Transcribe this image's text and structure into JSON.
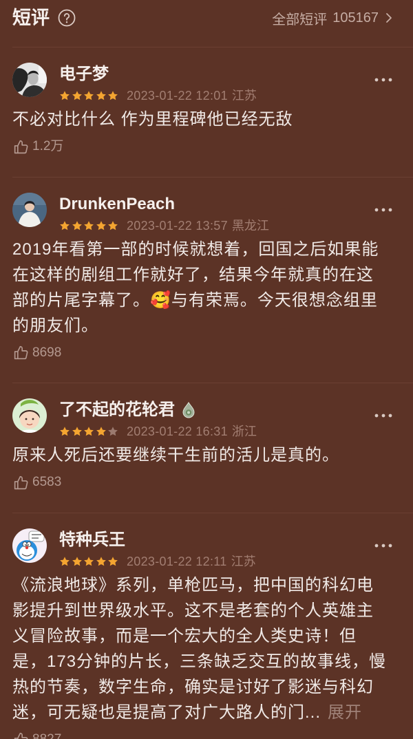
{
  "theme": {
    "background": "#5c3326",
    "text_primary": "#f2ebe8",
    "text_muted": "#a27e72",
    "star_filled": "#f4a531",
    "star_empty": "#9b7a6f",
    "divider": "#6b3f32"
  },
  "header": {
    "title": "短评",
    "help_icon": "question-circle-icon",
    "all_reviews_label": "全部短评",
    "all_reviews_count": "105167",
    "chevron_icon": "chevron-right-icon"
  },
  "reviews": [
    {
      "author": "电子梦",
      "rating": 5,
      "rating_max": 5,
      "date": "2023-01-22 12:01",
      "location": "江苏",
      "text": "不必对比什么 作为里程碑他已经无敌",
      "likes": "1.2万",
      "like_icon": "thumbs-up-icon",
      "more_icon": "more-dots-icon"
    },
    {
      "author": "DrunkenPeach",
      "rating": 5,
      "rating_max": 5,
      "date": "2023-01-22 13:57",
      "location": "黑龙江",
      "text": "2019年看第一部的时候就想着，回国之后如果能在这样的剧组工作就好了，结果今年就真的在这部的片尾字幕了。🥰与有荣焉。今天很想念组里的朋友们。",
      "likes": "8698",
      "like_icon": "thumbs-up-icon",
      "more_icon": "more-dots-icon"
    },
    {
      "author": "了不起的花轮君",
      "badge_icon": "medal-badge-icon",
      "rating": 4,
      "rating_max": 5,
      "date": "2023-01-22 16:31",
      "location": "浙江",
      "text": "原来人死后还要继续干生前的活儿是真的。",
      "likes": "6583",
      "like_icon": "thumbs-up-icon",
      "more_icon": "more-dots-icon"
    },
    {
      "author": "特种兵王",
      "rating": 5,
      "rating_max": 5,
      "date": "2023-01-22 12:11",
      "location": "江苏",
      "text": "《流浪地球》系列，单枪匹马，把中国的科幻电影提升到世界级水平。这不是老套的个人英雄主义冒险故事，而是一个宏大的全人类史诗！但是，173分钟的片长，三条缺乏交互的故事线，慢热的节奏，数字生命，确实是讨好了影迷与科幻迷，可无疑也是提高了对广大路人的门...",
      "expand_label": "展开",
      "likes": "8827",
      "like_icon": "thumbs-up-icon",
      "more_icon": "more-dots-icon"
    }
  ]
}
